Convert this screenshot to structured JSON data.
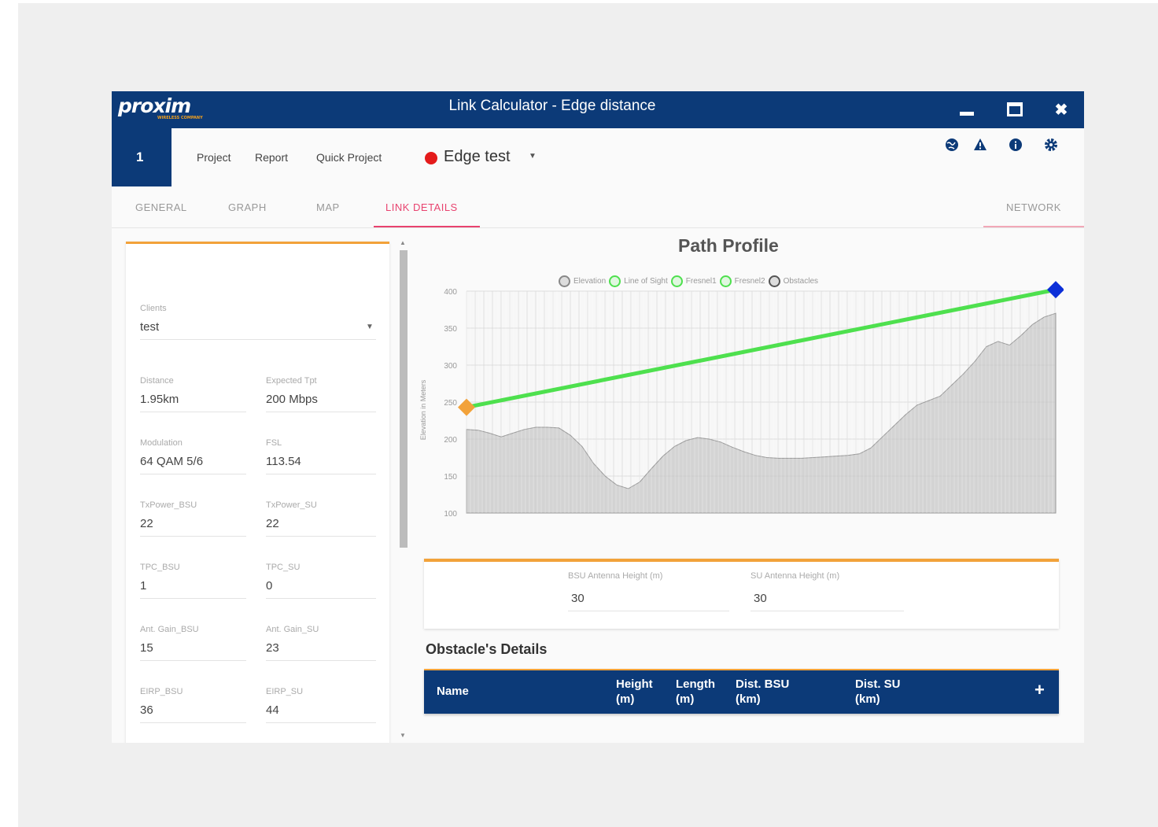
{
  "titlebar": {
    "logo": "proxim",
    "logo_tag": "WIRELESS COMPANY",
    "title": "Link Calculator - Edge distance",
    "minimize_icon": "minimize-icon",
    "maximize_icon": "maximize-icon",
    "close": "✖"
  },
  "toolbar": {
    "project_number": "1",
    "menu": [
      "Project",
      "Report",
      "Quick Project"
    ],
    "project_name": "Edge test",
    "status_color": "#e41b1b",
    "icons": [
      "globe-icon",
      "warning-icon",
      "info-icon",
      "settings-icon"
    ]
  },
  "tabs": {
    "items": [
      "GENERAL",
      "GRAPH",
      "MAP",
      "LINK DETAILS",
      "NETWORK"
    ],
    "active": "LINK DETAILS"
  },
  "left_panel": {
    "clients": {
      "label": "Clients",
      "value": "test"
    },
    "fields": [
      {
        "label": "Distance",
        "value": "1.95km"
      },
      {
        "label": "Expected Tpt",
        "value": "200 Mbps"
      },
      {
        "label": "Modulation",
        "value": "64 QAM 5/6"
      },
      {
        "label": "FSL",
        "value": "113.54"
      },
      {
        "label": "TxPower_BSU",
        "value": "22"
      },
      {
        "label": "TxPower_SU",
        "value": "22"
      },
      {
        "label": "TPC_BSU",
        "value": "1"
      },
      {
        "label": "TPC_SU",
        "value": "0"
      },
      {
        "label": "Ant. Gain_BSU",
        "value": "15"
      },
      {
        "label": "Ant. Gain_SU",
        "value": "23"
      },
      {
        "label": "EIRP_BSU",
        "value": "36"
      },
      {
        "label": "EIRP_SU",
        "value": "44"
      }
    ]
  },
  "chart": {
    "title": "Path Profile",
    "legend": [
      "Elevation",
      "Line of Sight",
      "Fresnel1",
      "Fresnel2",
      "Obstacles"
    ],
    "ylabel": "Elevation in Meters",
    "yticks": [
      "400",
      "350",
      "300",
      "250",
      "200",
      "150",
      "100"
    ]
  },
  "chart_data": {
    "type": "area",
    "title": "Path Profile",
    "ylabel": "Elevation in Meters",
    "ylim": [
      100,
      400
    ],
    "grid": true,
    "legend_position": "top",
    "series": [
      {
        "name": "Elevation",
        "color": "#c8c8c8",
        "values": [
          213,
          212,
          208,
          203,
          208,
          213,
          216,
          216,
          215,
          205,
          190,
          167,
          150,
          138,
          133,
          142,
          160,
          177,
          190,
          198,
          202,
          200,
          196,
          189,
          183,
          178,
          175,
          174,
          174,
          174,
          175,
          176,
          177,
          178,
          180,
          188,
          203,
          218,
          233,
          246,
          252,
          258,
          273,
          288,
          305,
          325,
          332,
          327,
          340,
          355,
          365,
          370
        ]
      },
      {
        "name": "Line of Sight",
        "color": "#4ee04e",
        "values": [
          243,
          249,
          255,
          261,
          268,
          274,
          280,
          286,
          292,
          298,
          304,
          310,
          316,
          322,
          328,
          334,
          341,
          347,
          353,
          359,
          365,
          371,
          377,
          383,
          389,
          395,
          401
        ],
        "note_endpoints": [
          243,
          402
        ]
      }
    ],
    "endpoints": [
      {
        "name": "BSU",
        "value": 243,
        "color": "#f2a23a"
      },
      {
        "name": "SU",
        "value": 402,
        "color": "#0c2fd8"
      }
    ]
  },
  "antenna": {
    "bsu_label": "BSU Antenna Height (m)",
    "bsu_value": "30",
    "su_label": "SU Antenna Height (m)",
    "su_value": "30"
  },
  "obstacles": {
    "title": "Obstacle's Details",
    "columns": [
      "Name",
      "Height (m)",
      "Length (m)",
      "Dist. BSU (km)",
      "Dist. SU (km)"
    ],
    "add": "+"
  }
}
